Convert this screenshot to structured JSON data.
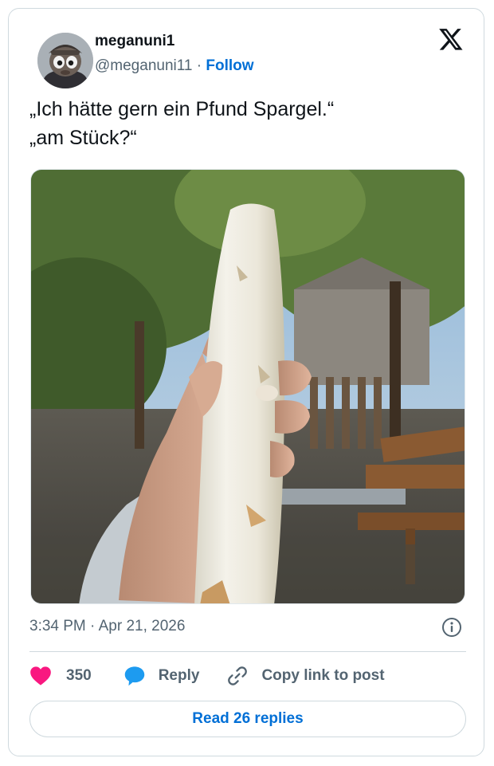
{
  "author": {
    "name": "meganuni1",
    "handle": "@meganuni11",
    "separator": "·",
    "follow_label": "Follow"
  },
  "tweet": {
    "lines": [
      "„Ich hätte gern ein Pfund Spargel.“",
      "„am Stück?“"
    ]
  },
  "meta": {
    "time": "3:34 PM",
    "separator": "·",
    "date": "Apr 21, 2026"
  },
  "actions": {
    "likes": "350",
    "reply_label": "Reply",
    "copy_label": "Copy link to post"
  },
  "read_replies_label": "Read 26 replies",
  "colors": {
    "like": "#f91880",
    "reply": "#1d9bf0",
    "link": "#006fd6",
    "muted": "#536471"
  },
  "icons": [
    "x-logo-icon",
    "info-icon",
    "heart-icon",
    "reply-bubble-icon",
    "link-icon"
  ]
}
